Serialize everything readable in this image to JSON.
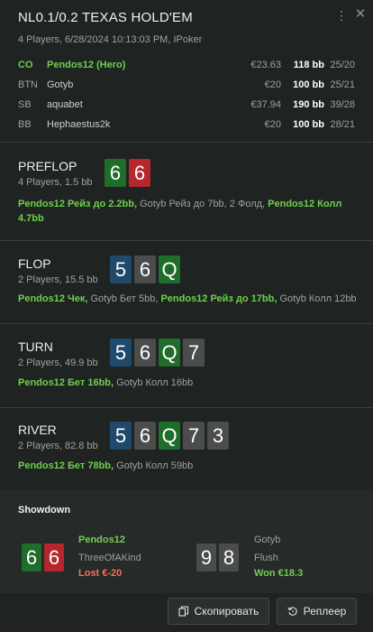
{
  "header": {
    "title": "NL0.1/0.2 TEXAS HOLD'EM",
    "subtitle": "4 Players, 6/28/2024 10:13:03 PM, IPoker",
    "menu_icon": "⋮",
    "close_icon": "✕"
  },
  "players": [
    {
      "pos": "CO",
      "name": "Pendos12 (Hero)",
      "stack_eur": "€23.63",
      "stack_bb": "118 bb",
      "stat": "25/20",
      "hero": true
    },
    {
      "pos": "BTN",
      "name": "Gotyb",
      "stack_eur": "€20",
      "stack_bb": "100 bb",
      "stat": "25/21",
      "hero": false
    },
    {
      "pos": "SB",
      "name": "aquabet",
      "stack_eur": "€37.94",
      "stack_bb": "190 bb",
      "stat": "39/28",
      "hero": false
    },
    {
      "pos": "BB",
      "name": "Hephaestus2k",
      "stack_eur": "€20",
      "stack_bb": "100 bb",
      "stat": "28/21",
      "hero": false
    }
  ],
  "streets": {
    "preflop": {
      "name": "PREFLOP",
      "info": "4 Players, 1.5 bb",
      "cards": [
        {
          "rank": "6",
          "suit_color": "green"
        },
        {
          "rank": "6",
          "suit_color": "red"
        }
      ],
      "actions": [
        {
          "text": "Pendos12 Рейз до 2.2bb,",
          "hero": true
        },
        {
          "text": "Gotyb Рейз до 7bb, 2 Фолд,",
          "hero": false
        },
        {
          "text": "Pendos12 Колл 4.7bb",
          "hero": true
        }
      ]
    },
    "flop": {
      "name": "FLOP",
      "info": "2 Players, 15.5 bb",
      "cards": [
        {
          "rank": "5",
          "suit_color": "blue"
        },
        {
          "rank": "6",
          "suit_color": "gray"
        },
        {
          "rank": "Q",
          "suit_color": "green"
        }
      ],
      "actions": [
        {
          "text": "Pendos12 Чек,",
          "hero": true
        },
        {
          "text": "Gotyb Бет 5bb,",
          "hero": false
        },
        {
          "text": "Pendos12 Рейз до 17bb,",
          "hero": true
        },
        {
          "text": "Gotyb Колл 12bb",
          "hero": false
        }
      ]
    },
    "turn": {
      "name": "TURN",
      "info": "2 Players, 49.9 bb",
      "cards": [
        {
          "rank": "5",
          "suit_color": "blue"
        },
        {
          "rank": "6",
          "suit_color": "gray"
        },
        {
          "rank": "Q",
          "suit_color": "green"
        },
        {
          "rank": "7",
          "suit_color": "gray"
        }
      ],
      "actions": [
        {
          "text": "Pendos12 Бет 16bb,",
          "hero": true
        },
        {
          "text": "Gotyb Колл 16bb",
          "hero": false
        }
      ]
    },
    "river": {
      "name": "RIVER",
      "info": "2 Players, 82.8 bb",
      "cards": [
        {
          "rank": "5",
          "suit_color": "blue"
        },
        {
          "rank": "6",
          "suit_color": "gray"
        },
        {
          "rank": "Q",
          "suit_color": "green"
        },
        {
          "rank": "7",
          "suit_color": "gray"
        },
        {
          "rank": "3",
          "suit_color": "gray"
        }
      ],
      "actions": [
        {
          "text": "Pendos12 Бет 78bb,",
          "hero": true
        },
        {
          "text": "Gotyb Колл 59bb",
          "hero": false
        }
      ]
    }
  },
  "showdown": {
    "title": "Showdown",
    "hero": {
      "name": "Pendos12",
      "hand": "ThreeOfAKind",
      "result": "Lost €-20",
      "cards": [
        {
          "rank": "6",
          "suit_color": "green"
        },
        {
          "rank": "6",
          "suit_color": "red"
        }
      ]
    },
    "villain": {
      "name": "Gotyb",
      "hand": "Flush",
      "result": "Won €18.3",
      "cards": [
        {
          "rank": "9",
          "suit_color": "gray"
        },
        {
          "rank": "8",
          "suit_color": "gray"
        }
      ]
    }
  },
  "footer": {
    "copy_label": "Скопировать",
    "copy_icon": "copy-icon",
    "replay_label": "Реплеер",
    "replay_icon": "replay-icon"
  },
  "colors": {
    "hero_green": "#6fcf4f",
    "lost_red": "#ff6b5a",
    "won_green": "#6fcf4f",
    "card_green": "#1f6d2b",
    "card_red": "#b5262e",
    "card_blue": "#1f4a6b",
    "card_gray": "#4a4d4c"
  }
}
